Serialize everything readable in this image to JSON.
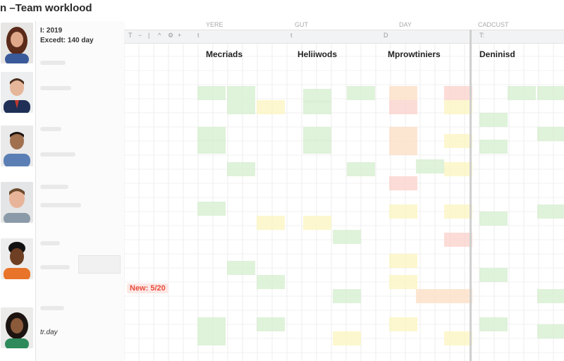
{
  "window": {
    "title": "n –Team worklood"
  },
  "header": {
    "top_labels": [
      "YERE",
      "GUT",
      "DAY",
      "CADCUST"
    ],
    "column_letters": [
      "T",
      "t",
      "t",
      "D",
      "T:"
    ]
  },
  "info": {
    "year_label": "I: 2019",
    "excedit_label": "Excedt: 140 day",
    "new_badge": "New: 5/20",
    "bottom_note": "tr.day"
  },
  "groups": [
    {
      "label": "Mecriads"
    },
    {
      "label": "Heliiwods"
    },
    {
      "label": "Mprowtiniers"
    },
    {
      "label": "Deninisd"
    }
  ],
  "people": [
    {
      "name_icon": "person-avatar-1"
    },
    {
      "name_icon": "person-avatar-2"
    },
    {
      "name_icon": "person-avatar-3"
    },
    {
      "name_icon": "person-avatar-4"
    },
    {
      "name_icon": "person-avatar-5"
    },
    {
      "name_icon": "person-avatar-6"
    }
  ],
  "colors": {
    "green": "#d9f0d3",
    "yellow": "#fbf6c5",
    "orange": "#fde2c9",
    "red": "#fbd6d0",
    "accent_red": "#e74c3c"
  }
}
